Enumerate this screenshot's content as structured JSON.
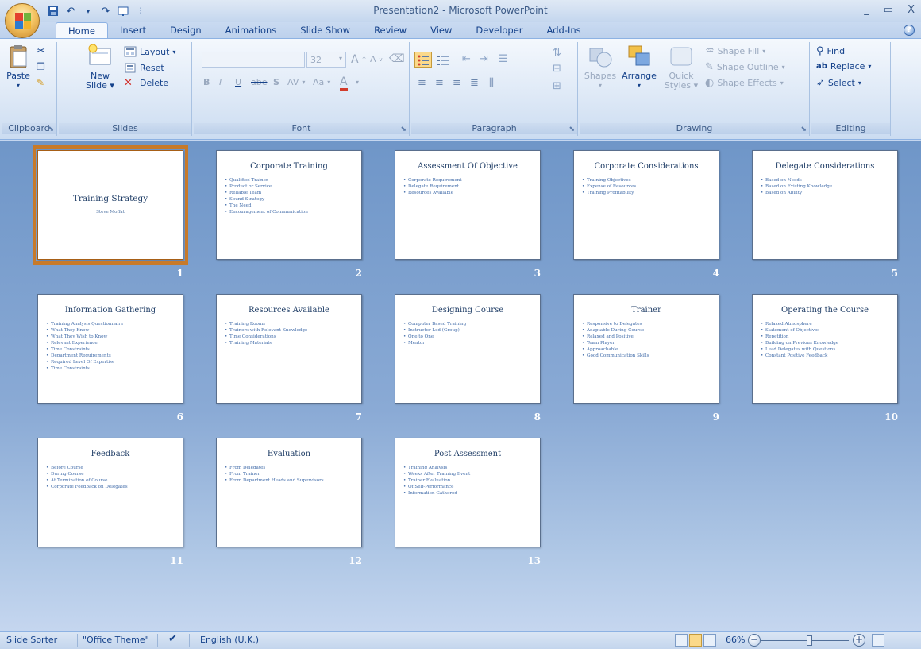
{
  "window": {
    "title": "Presentation2 - Microsoft PowerPoint",
    "minimize": "_",
    "restore": "▭",
    "close": "X"
  },
  "tabs": [
    {
      "label": "Home",
      "active": true
    },
    {
      "label": "Insert"
    },
    {
      "label": "Design"
    },
    {
      "label": "Animations"
    },
    {
      "label": "Slide Show"
    },
    {
      "label": "Review"
    },
    {
      "label": "View"
    },
    {
      "label": "Developer"
    },
    {
      "label": "Add-Ins"
    }
  ],
  "ribbon": {
    "clipboard": {
      "label": "Clipboard",
      "paste": "Paste"
    },
    "slides": {
      "label": "Slides",
      "new_slide_1": "New",
      "new_slide_2": "Slide",
      "layout": "Layout",
      "reset": "Reset",
      "delete": "Delete"
    },
    "font": {
      "label": "Font",
      "size": "32",
      "bold": "B",
      "italic": "I",
      "underline": "U",
      "strike": "abe",
      "shadow": "S",
      "spacing": "AV",
      "case": "Aa",
      "color": "A",
      "grow": "A",
      "shrink": "A"
    },
    "paragraph": {
      "label": "Paragraph"
    },
    "drawing": {
      "label": "Drawing",
      "shapes": "Shapes",
      "arrange": "Arrange",
      "quick_styles_1": "Quick",
      "quick_styles_2": "Styles",
      "shape_fill": "Shape Fill",
      "shape_outline": "Shape Outline",
      "shape_effects": "Shape Effects"
    },
    "editing": {
      "label": "Editing",
      "find": "Find",
      "replace": "Replace",
      "select": "Select"
    }
  },
  "slides": [
    {
      "n": "1",
      "title": "Training Strategy",
      "subtitle": "Steve Moffat",
      "bullets": [],
      "selected": true
    },
    {
      "n": "2",
      "title": "Corporate Training",
      "bullets": [
        "Qualified Trainer",
        "Product or Service",
        "Reliable Team",
        "Sound Strategy",
        "The Need",
        "Encouragement of Communication"
      ]
    },
    {
      "n": "3",
      "title": "Assessment Of Objective",
      "bullets": [
        "Corporate Requirement",
        "Delegate Requirement",
        "Resources Available"
      ]
    },
    {
      "n": "4",
      "title": "Corporate Considerations",
      "bullets": [
        "Training Objectives",
        "Expense of Resources",
        "Training Profitability"
      ]
    },
    {
      "n": "5",
      "title": "Delegate Considerations",
      "bullets": [
        "Based on Needs",
        "Based on Existing Knowledge",
        "Based on Ability"
      ]
    },
    {
      "n": "6",
      "title": "Information Gathering",
      "bullets": [
        "Training Analysis Questionnaire",
        "What They Know",
        "What They Wish to Know",
        "Relevant Experience",
        "Time Constraints",
        "Department Requirements",
        "Required Level Of Expertise",
        "Time Constraints"
      ]
    },
    {
      "n": "7",
      "title": "Resources Available",
      "bullets": [
        "Training Rooms",
        "Trainers with Relevant Knowledge",
        "Time Considerations",
        "Training Materials"
      ]
    },
    {
      "n": "8",
      "title": "Designing Course",
      "bullets": [
        "Computer Based Training",
        "Instructor Led (Group)",
        "One to One",
        "Mentor"
      ]
    },
    {
      "n": "9",
      "title": "Trainer",
      "bullets": [
        "Responsive to Delegates",
        "Adaptable During Course",
        "Relaxed and Positive",
        "Team Player",
        "Approachable",
        "Good Communication Skills"
      ]
    },
    {
      "n": "10",
      "title": "Operating the Course",
      "bullets": [
        "Relaxed Atmosphere",
        "Statement of Objectives",
        "Repetition",
        "Building on Previous Knowledge",
        "Lead Delegates with Questions",
        "Constant Positive Feedback"
      ]
    },
    {
      "n": "11",
      "title": "Feedback",
      "bullets": [
        "Before Course",
        "During Course",
        "At Termination of Course",
        "Corporate Feedback on Delegates"
      ]
    },
    {
      "n": "12",
      "title": "Evaluation",
      "bullets": [
        "From Delegates",
        "From Trainer",
        "From Department Heads and Supervisors"
      ]
    },
    {
      "n": "13",
      "title": "Post Assessment",
      "bullets": [
        "Training Analysis",
        "Weeks After Training Event",
        "Trainer Evaluation",
        "Of Self-Performance",
        "Information Gathered"
      ]
    }
  ],
  "status": {
    "view": "Slide Sorter",
    "theme": "\"Office Theme\"",
    "language": "English (U.K.)",
    "zoom": "66%",
    "zoom_fraction": 0.55
  },
  "colors": {
    "accent": "#c77a2a",
    "ribbon_text": "#15428b",
    "sorter_bg": "#7f9fcd"
  }
}
